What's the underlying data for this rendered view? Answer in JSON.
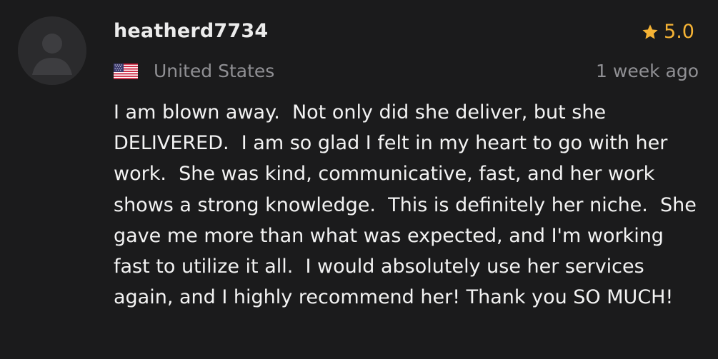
{
  "review": {
    "username": "heatherd7734",
    "rating": "5.0",
    "country": "United States",
    "time_ago": "1 week ago",
    "text": "I am blown away.  Not only did she deliver, but she DELIVERED.  I am so glad I felt in my heart to go with her work.  She was kind, communicative, fast, and her work shows a strong knowledge.  This is definitely her niche.  She gave me more than what was expected, and I'm working fast to utilize it all.  I would absolutely use her services again, and I highly recommend her! Thank you SO MUCH!"
  },
  "icons": {
    "avatar": "user-silhouette-icon",
    "star": "star-icon",
    "flag": "us-flag-icon"
  },
  "colors": {
    "background": "#1b1b1c",
    "star": "#f5b335",
    "muted_text": "#909094"
  }
}
